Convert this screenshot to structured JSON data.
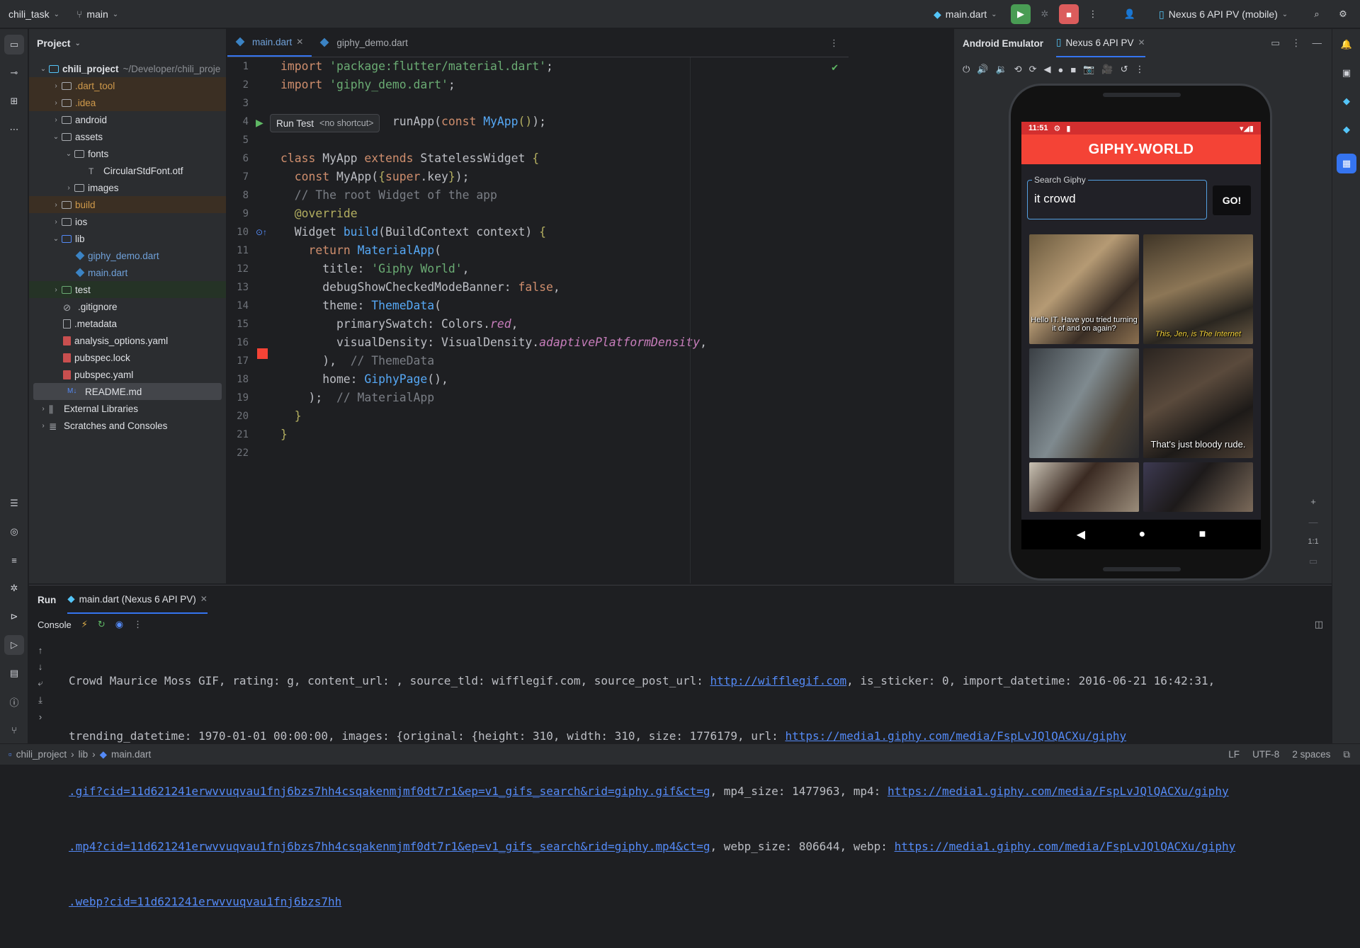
{
  "topbar": {
    "project": "chili_task",
    "branch": "main",
    "run_config": "main.dart",
    "device": "Nexus 6 API PV (mobile)"
  },
  "project_panel": {
    "title": "Project",
    "root_name": "chili_project",
    "root_path": "~/Developer/chili_proje",
    "items": [
      ".dart_tool",
      ".idea",
      "android",
      "assets",
      "fonts",
      "CircularStdFont.otf",
      "images",
      "build",
      "ios",
      "lib",
      "giphy_demo.dart",
      "main.dart",
      "test",
      ".gitignore",
      ".metadata",
      "analysis_options.yaml",
      "pubspec.lock",
      "pubspec.yaml",
      "README.md",
      "External Libraries",
      "Scratches and Consoles"
    ]
  },
  "editor": {
    "tabs": [
      "main.dart",
      "giphy_demo.dart"
    ],
    "line_numbers": [
      "1",
      "2",
      "3",
      "4",
      "5",
      "6",
      "7",
      "8",
      "9",
      "10",
      "11",
      "12",
      "13",
      "14",
      "15",
      "16",
      "17",
      "18",
      "19",
      "20",
      "21",
      "22"
    ],
    "tooltip": {
      "label": "Run Test",
      "shortcut": "<no shortcut>"
    }
  },
  "emulator": {
    "title": "Android Emulator",
    "tab": "Nexus 6 API PV",
    "time": "11:51",
    "app_title": "GIPHY-WORLD",
    "search_label": "Search Giphy",
    "search_value": "it crowd",
    "go": "GO!",
    "captions": {
      "g1": "Hello IT. Have you tried turning it of and on again?",
      "g2": "This, Jen, is The Internet",
      "g4": "That's just bloody rude."
    },
    "zoom": "1:1"
  },
  "run": {
    "tab_run": "Run",
    "config": "main.dart (Nexus 6 API PV)",
    "console": "Console",
    "lines": [
      {
        "t": "Crowd Maurice Moss GIF, rating: g, content_url: , source_tld: wifflegif.com, source_post_url: ",
        "link": "http://wifflegif.com",
        "t2": ", is_sticker: 0, import_datetime: 2016-06-21 16:42:31,"
      },
      {
        "t": "trending_datetime: 1970-01-01 00:00:00, images: {original: {height: 310, width: 310, size: 1776179, url: ",
        "link": "https://media1.giphy.com/media/FspLvJQlQACXu/giphy",
        "t2": ""
      },
      {
        "t": "",
        "link": ".gif?cid=11d621241erwvvuqvau1fnj6bzs7hh4csqakenmjmf0dt7r1&ep=v1_gifs_search&rid=giphy.gif&ct=g",
        "t2": ", mp4_size: 1477963, mp4: ",
        "link2": "https://media1.giphy.com/media/FspLvJQlQACXu/giphy"
      },
      {
        "t": "",
        "link": ".mp4?cid=11d621241erwvvuqvau1fnj6bzs7hh4csqakenmjmf0dt7r1&ep=v1_gifs_search&rid=giphy.mp4&ct=g",
        "t2": ", webp_size: 806644, webp: ",
        "link2": "https://media1.giphy.com/media/FspLvJQlQACXu/giphy"
      },
      {
        "t": "",
        "link": ".webp?cid=11d621241erwvvuqvau1fnj6bzs7hh",
        "t2": ""
      }
    ]
  },
  "status": {
    "crumbs": [
      "chili_project",
      "lib",
      "main.dart"
    ],
    "lf": "LF",
    "enc": "UTF-8",
    "indent": "2 spaces"
  },
  "colors": {
    "accent": "#3574f0",
    "app_red": "#f44336"
  }
}
